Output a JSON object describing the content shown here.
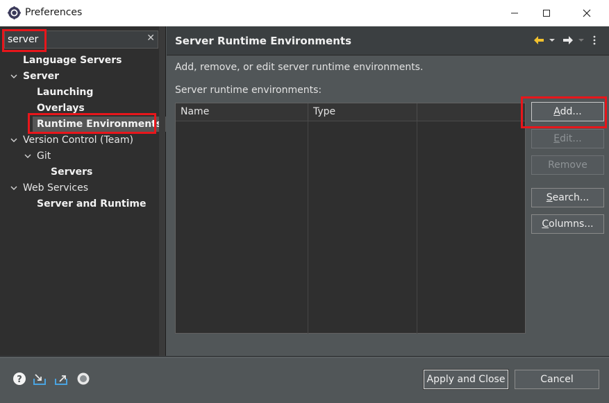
{
  "window": {
    "title": "Preferences",
    "minimize_glyph": "—",
    "maximize_glyph": "☐",
    "close_glyph": "✕"
  },
  "filter": {
    "value": "server",
    "clear_glyph": "✕"
  },
  "tree": [
    {
      "label": "Language Servers",
      "bold": true,
      "level": 1,
      "expanded": null
    },
    {
      "label": "Server",
      "bold": true,
      "level": 0,
      "expanded": true
    },
    {
      "label": "Launching",
      "bold": true,
      "level": 2,
      "expanded": null
    },
    {
      "label": "Overlays",
      "bold": true,
      "level": 2,
      "expanded": null
    },
    {
      "label": "Runtime Environments",
      "bold": true,
      "level": 2,
      "expanded": null,
      "selected": true
    },
    {
      "label": "Version Control (Team)",
      "bold": false,
      "level": 0,
      "expanded": true
    },
    {
      "label": "Git",
      "bold": false,
      "level": 1,
      "expanded": true
    },
    {
      "label": "Servers",
      "bold": true,
      "level": 3,
      "expanded": null
    },
    {
      "label": "Web Services",
      "bold": false,
      "level": 0,
      "expanded": true
    },
    {
      "label": "Server and Runtime",
      "bold": true,
      "level": 2,
      "expanded": null
    }
  ],
  "page": {
    "title": "Server Runtime Environments",
    "description": "Add, remove, or edit server runtime environments.",
    "list_label": "Server runtime environments:",
    "columns": [
      "Name",
      "Type",
      ""
    ]
  },
  "buttons": {
    "add": {
      "label": "Add...",
      "mnemonic": "A",
      "enabled": true
    },
    "edit": {
      "label": "Edit...",
      "mnemonic": "E",
      "enabled": false
    },
    "remove": {
      "label": "Remove",
      "mnemonic": "",
      "enabled": false
    },
    "search": {
      "label": "Search...",
      "mnemonic": "S",
      "enabled": true
    },
    "columns": {
      "label": "Columns...",
      "mnemonic": "C",
      "enabled": true
    }
  },
  "footer": {
    "apply_close": "Apply and Close",
    "cancel": "Cancel",
    "icons": [
      "help-icon",
      "import-icon",
      "export-icon",
      "record-icon"
    ]
  },
  "colors": {
    "highlight_red": "#e8161b",
    "nav_arrow_yellow": "#f2c12e"
  }
}
